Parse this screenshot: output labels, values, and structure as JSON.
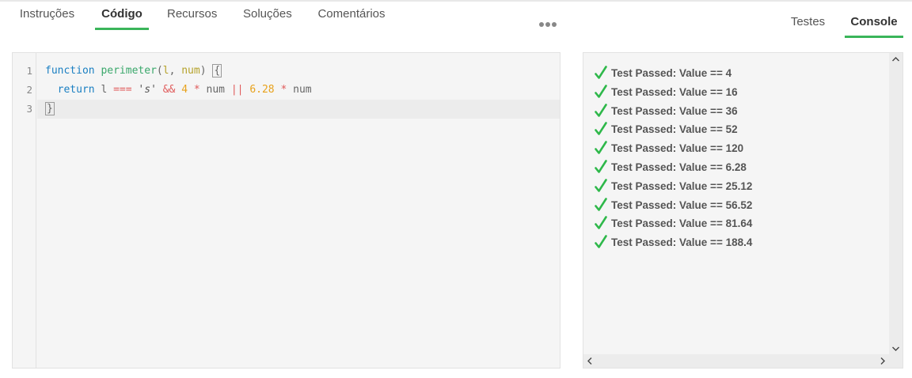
{
  "left_tabs": [
    "Instruções",
    "Código",
    "Recursos",
    "Soluções",
    "Comentários"
  ],
  "right_tabs": [
    "Testes",
    "Console"
  ],
  "editor": {
    "line_numbers": [
      "1",
      "2",
      "3"
    ],
    "line1": {
      "kw": "function",
      "fn": "perimeter",
      "open": "(",
      "p1": "l",
      "comma": ", ",
      "p2": "num",
      "close": ")",
      "brace": "{"
    },
    "line2": {
      "indent": "  ",
      "kw": "return",
      "var": " l ",
      "eq": "===",
      "str": " 's' ",
      "and": "&&",
      "n1": " 4",
      "mul1": " *",
      "v1": " num ",
      "or": "||",
      "n2": " 6.28",
      "mul2": " *",
      "v2": " num"
    },
    "line3": {
      "brace": "}"
    }
  },
  "console": {
    "results": [
      "Test Passed: Value == 4",
      "Test Passed: Value == 16",
      "Test Passed: Value == 36",
      "Test Passed: Value == 52",
      "Test Passed: Value == 120",
      "Test Passed: Value == 6.28",
      "Test Passed: Value == 25.12",
      "Test Passed: Value == 56.52",
      "Test Passed: Value == 81.64",
      "Test Passed: Value == 188.4"
    ],
    "scroll_up": "⌃",
    "scroll_down": "⌄",
    "scroll_left": "<",
    "scroll_right": ">"
  },
  "colors": {
    "accent": "#3ab55a",
    "check": "#2eb84a"
  },
  "icons": [
    "more-icon",
    "check-icon"
  ]
}
